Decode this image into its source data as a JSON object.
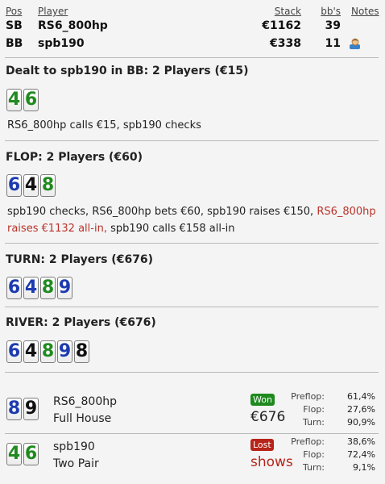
{
  "header": {
    "col_pos": "Pos",
    "col_player": "Player",
    "col_stack": "Stack",
    "col_bbs": "bb's",
    "col_notes": "Notes",
    "rows": [
      {
        "pos": "SB",
        "player": "RS6_800hp",
        "stack": "€1162",
        "bbs": "39"
      },
      {
        "pos": "BB",
        "player": "spb190",
        "stack": "€338",
        "bbs": "11",
        "notes_icon": "user-notes-icon"
      }
    ]
  },
  "preflop": {
    "title": "Dealt to spb190 in BB: 2 Players (€15)",
    "cards": [
      {
        "rank": "4",
        "suit": "c"
      },
      {
        "rank": "6",
        "suit": "c"
      }
    ],
    "actions": "RS6_800hp calls €15, spb190 checks"
  },
  "flop": {
    "title": "FLOP: 2 Players (€60)",
    "cards": [
      {
        "rank": "6",
        "suit": "d"
      },
      {
        "rank": "4",
        "suit": "s"
      },
      {
        "rank": "8",
        "suit": "c"
      }
    ],
    "actions_a": "spb190 checks, RS6_800hp bets €60, spb190 raises €150, ",
    "actions_b": "RS6_800hp",
    "actions_c": "raises €1132 all-in,",
    "actions_d": " spb190 calls €158 all-in"
  },
  "turn": {
    "title": "TURN: 2 Players (€676)",
    "cards": [
      {
        "rank": "6",
        "suit": "d"
      },
      {
        "rank": "4",
        "suit": "d"
      },
      {
        "rank": "8",
        "suit": "c"
      },
      {
        "rank": "9",
        "suit": "d"
      }
    ]
  },
  "river": {
    "title": "RIVER: 2 Players (€676)",
    "cards": [
      {
        "rank": "6",
        "suit": "d"
      },
      {
        "rank": "4",
        "suit": "s"
      },
      {
        "rank": "8",
        "suit": "c"
      },
      {
        "rank": "9",
        "suit": "d"
      },
      {
        "rank": "8",
        "suit": "s"
      }
    ]
  },
  "results": [
    {
      "player": "RS6_800hp",
      "hand": "Full House",
      "cards": [
        {
          "rank": "8",
          "suit": "d"
        },
        {
          "rank": "9",
          "suit": "s"
        }
      ],
      "badge": "Won",
      "amount": "€676",
      "stats": [
        {
          "label": "Preflop:",
          "value": "61,4%"
        },
        {
          "label": "Flop:",
          "value": "27,6%"
        },
        {
          "label": "Turn:",
          "value": "90,9%"
        }
      ]
    },
    {
      "player": "spb190",
      "hand": "Two Pair",
      "cards": [
        {
          "rank": "4",
          "suit": "c"
        },
        {
          "rank": "6",
          "suit": "c"
        }
      ],
      "badge": "Lost",
      "amount": "shows",
      "stats": [
        {
          "label": "Preflop:",
          "value": "38,6%"
        },
        {
          "label": "Flop:",
          "value": "72,4%"
        },
        {
          "label": "Turn:",
          "value": "9,1%"
        }
      ]
    }
  ],
  "colors": {
    "won": "#1e8a1e",
    "lost": "#b72419",
    "club": "#1f8a1f",
    "diamond": "#1d3bb0",
    "spade": "#111111",
    "heart": "#c01a1a"
  }
}
